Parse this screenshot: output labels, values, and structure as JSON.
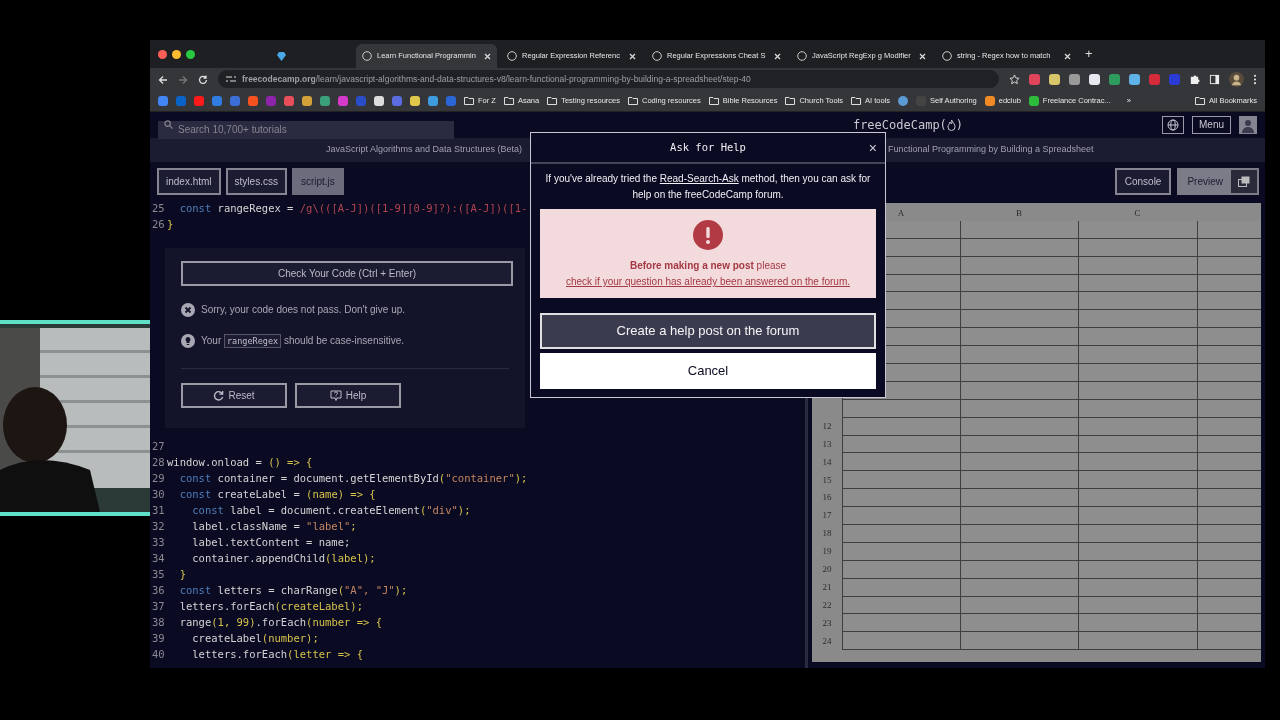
{
  "tabs": [
    {
      "kind": "pinned",
      "selected": false
    },
    {
      "kind": "page",
      "title": "Learn Functional Programmin",
      "selected": true
    },
    {
      "kind": "page",
      "title": "Regular Expression Referenc",
      "selected": false
    },
    {
      "kind": "page",
      "title": "Regular Expressions Cheat S",
      "selected": false
    },
    {
      "kind": "page",
      "title": "JavaScript RegExp g Modifier",
      "selected": false
    },
    {
      "kind": "page",
      "title": "string - Regex how to match",
      "selected": false
    }
  ],
  "new_tab": "+",
  "address": {
    "url": "**freecodecamp.org**/learn/javascript-algorithms-and-data-structures-v8/learn-functional-programming-by-building-a-spreadsheet/step-40"
  },
  "extension_icons": [
    {
      "color": "#e0455c"
    },
    {
      "color": "#d9c66a"
    },
    {
      "color": "#9a9a9a"
    },
    {
      "color": "#e8e8f0"
    },
    {
      "color": "#2e9c5e"
    },
    {
      "color": "#5fb3e8"
    },
    {
      "color": "#d62b3a"
    },
    {
      "color": "#2b3bd6"
    }
  ],
  "bookmark_icons": [
    {
      "color": "#4285f4"
    },
    {
      "color": "#0a64c8"
    },
    {
      "color": "#ff1a1a"
    },
    {
      "color": "#2f7de1"
    },
    {
      "color": "#3b6fd6"
    },
    {
      "color": "#f4511e"
    },
    {
      "color": "#8e24aa"
    },
    {
      "color": "#e94e5b"
    },
    {
      "color": "#d4a03a"
    },
    {
      "color": "#3aa17a"
    },
    {
      "color": "#d63acb"
    },
    {
      "color": "#2a4dc8"
    },
    {
      "color": "#dddddd"
    },
    {
      "color": "#5b6be0"
    },
    {
      "color": "#e2c84a"
    },
    {
      "color": "#3d9be0"
    },
    {
      "color": "#2a66d6"
    }
  ],
  "bookmarks": [
    {
      "kind": "folder",
      "label": "For Z"
    },
    {
      "kind": "folder",
      "label": "Asana"
    },
    {
      "kind": "folder",
      "label": "Testing resources"
    },
    {
      "kind": "folder",
      "label": "Coding resources"
    },
    {
      "kind": "folder",
      "label": "Bible Resources"
    },
    {
      "kind": "folder",
      "label": "Church Tools"
    },
    {
      "kind": "folder",
      "label": "AI tools"
    },
    {
      "kind": "site",
      "color": "#5b9bd5"
    },
    {
      "kind": "site",
      "label": "Self Authoring",
      "color": "#444444"
    },
    {
      "kind": "site",
      "label": "edclub",
      "color": "#f08a24"
    },
    {
      "kind": "site",
      "label": "Freelance Contrac...",
      "color": "#2dbb3c"
    }
  ],
  "bookmarks_more": "»",
  "all_bookmarks": "All Bookmarks",
  "fcc_nav": {
    "search_placeholder": "Search 10,700+ tutorials",
    "logo_before": "freeCodeCamp(",
    "logo_after": ")",
    "menu": "Menu"
  },
  "breadcrumb": [
    "JavaScript Algorithms and Data Structures (Beta)",
    "Functional Programming by Building a Spreadsheet"
  ],
  "file_tabs": [
    {
      "label": "index.html",
      "selected": false
    },
    {
      "label": "styles.css",
      "selected": false
    },
    {
      "label": "script.js",
      "selected": true
    }
  ],
  "code_top": [
    {
      "number": "25",
      "tokens": [
        {
          "kind": "kw",
          "text": "  const"
        },
        {
          "kind": "txt",
          "text": " rangeRegex = "
        },
        {
          "kind": "re",
          "text": "/g\\(([A-J])([1-9][0-9]?):([A-J])([1-"
        }
      ]
    },
    {
      "number": "26",
      "tokens": [
        {
          "kind": "punc",
          "text": "}"
        }
      ]
    }
  ],
  "test_panel": {
    "check_button": "Check Your Code (Ctrl + Enter)",
    "fail_message": "Sorry, your code does not pass. Don't give up.",
    "hint": {
      "before": "Your",
      "code": "rangeRegex",
      "after": "should be case-insensitive."
    },
    "buttons": [
      {
        "kind": "reset",
        "label": "Reset"
      },
      {
        "kind": "help",
        "label": "Help"
      }
    ]
  },
  "code_bottom": [
    {
      "number": "27"
    },
    {
      "number": "28",
      "tokens": [
        {
          "kind": "txt",
          "text": "window.onload = "
        },
        {
          "kind": "punc",
          "text": "() => {"
        }
      ]
    },
    {
      "number": "29",
      "tokens": [
        {
          "kind": "kw",
          "text": "  const"
        },
        {
          "kind": "txt",
          "text": " container = document.getElementById"
        },
        {
          "kind": "punc",
          "text": "("
        },
        {
          "kind": "str",
          "text": "\"container\""
        },
        {
          "kind": "punc",
          "text": ");"
        }
      ]
    },
    {
      "number": "30",
      "tokens": [
        {
          "kind": "kw",
          "text": "  const"
        },
        {
          "kind": "txt",
          "text": " createLabel = "
        },
        {
          "kind": "punc",
          "text": "(name) => {"
        }
      ]
    },
    {
      "number": "31",
      "tokens": [
        {
          "kind": "kw",
          "text": "    const"
        },
        {
          "kind": "txt",
          "text": " label = document.createElement"
        },
        {
          "kind": "punc",
          "text": "("
        },
        {
          "kind": "str",
          "text": "\"div\""
        },
        {
          "kind": "punc",
          "text": ");"
        }
      ]
    },
    {
      "number": "32",
      "tokens": [
        {
          "kind": "txt",
          "text": "    label.className = "
        },
        {
          "kind": "str",
          "text": "\"label\""
        },
        {
          "kind": "punc",
          "text": ";"
        }
      ]
    },
    {
      "number": "33",
      "tokens": [
        {
          "kind": "txt",
          "text": "    label.textContent = name;"
        }
      ]
    },
    {
      "number": "34",
      "tokens": [
        {
          "kind": "txt",
          "text": "    container.appendChild"
        },
        {
          "kind": "punc",
          "text": "(label);"
        }
      ]
    },
    {
      "number": "35",
      "tokens": [
        {
          "kind": "punc",
          "text": "  }"
        }
      ]
    },
    {
      "number": "36",
      "tokens": [
        {
          "kind": "kw",
          "text": "  const"
        },
        {
          "kind": "txt",
          "text": " letters = charRange"
        },
        {
          "kind": "punc",
          "text": "("
        },
        {
          "kind": "str",
          "text": "\"A\", \"J\""
        },
        {
          "kind": "punc",
          "text": ");"
        }
      ]
    },
    {
      "number": "37",
      "tokens": [
        {
          "kind": "txt",
          "text": "  letters.forEach"
        },
        {
          "kind": "punc",
          "text": "(createLabel);"
        }
      ]
    },
    {
      "number": "38",
      "tokens": [
        {
          "kind": "txt",
          "text": "  range"
        },
        {
          "kind": "punc",
          "text": "(1, 99)"
        },
        {
          "kind": "txt",
          "text": ".forEach"
        },
        {
          "kind": "punc",
          "text": "(number => {"
        }
      ]
    },
    {
      "number": "39",
      "tokens": [
        {
          "kind": "txt",
          "text": "    createLabel"
        },
        {
          "kind": "punc",
          "text": "(number);"
        }
      ]
    },
    {
      "number": "40",
      "tokens": [
        {
          "kind": "txt",
          "text": "    letters.forEach"
        },
        {
          "kind": "punc",
          "text": "(letter => {"
        }
      ]
    }
  ],
  "preview_toolbar": [
    {
      "label": "Console",
      "selected": false
    },
    {
      "label": "Preview",
      "selected": true
    }
  ],
  "spreadsheet": {
    "columns": [
      "A",
      "B",
      "C"
    ],
    "row_numbers": [
      "12",
      "13",
      "14",
      "15",
      "16",
      "17",
      "18",
      "19",
      "20",
      "21",
      "22",
      "23",
      "24"
    ]
  },
  "modal": {
    "title": "Ask for Help",
    "close": "×",
    "intro_before": "If you've already tried the",
    "intro_link": "Read-Search-Ask",
    "intro_after": "method, then you can ask for help on the freeCodeCamp forum.",
    "alert_bold": "Before making a new post",
    "alert_text": "please",
    "alert_link": "check if your question has already been answered on the forum.",
    "primary_button": "Create a help post on the forum",
    "cancel_button": "Cancel"
  }
}
